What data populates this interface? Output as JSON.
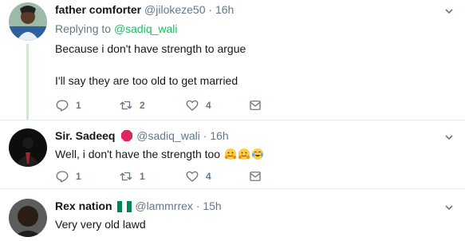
{
  "tweets": [
    {
      "display_name": "father comforter",
      "handle": "@jilokeze50",
      "separator": "·",
      "time": "16h",
      "replying_label": "Replying to",
      "replying_handle": "@sadiq_wali",
      "line1": "Because i don't have strength to argue",
      "line2": "I'll say they are too old to get married",
      "reply_count": "1",
      "retweet_count": "2",
      "like_count": "4"
    },
    {
      "display_name": "Sir. Sadeeq",
      "handle": "@sadiq_wali",
      "separator": "·",
      "time": "16h",
      "line1": "Well, i don't have the strength too",
      "reply_count": "1",
      "retweet_count": "1",
      "like_count": "4"
    },
    {
      "display_name": "Rex nation",
      "handle": "@lammrrex",
      "separator": "·",
      "time": "15h",
      "line1": "Very very old lawd"
    }
  ],
  "icons": {
    "reply": "reply-icon",
    "retweet": "retweet-icon",
    "like": "heart-icon",
    "dm": "envelope-icon",
    "more": "chevron-down-icon"
  },
  "colors": {
    "handle": "#657786",
    "link": "#17bf63",
    "thread_line": "#c4f0c4",
    "divider": "#e6ecf0"
  }
}
